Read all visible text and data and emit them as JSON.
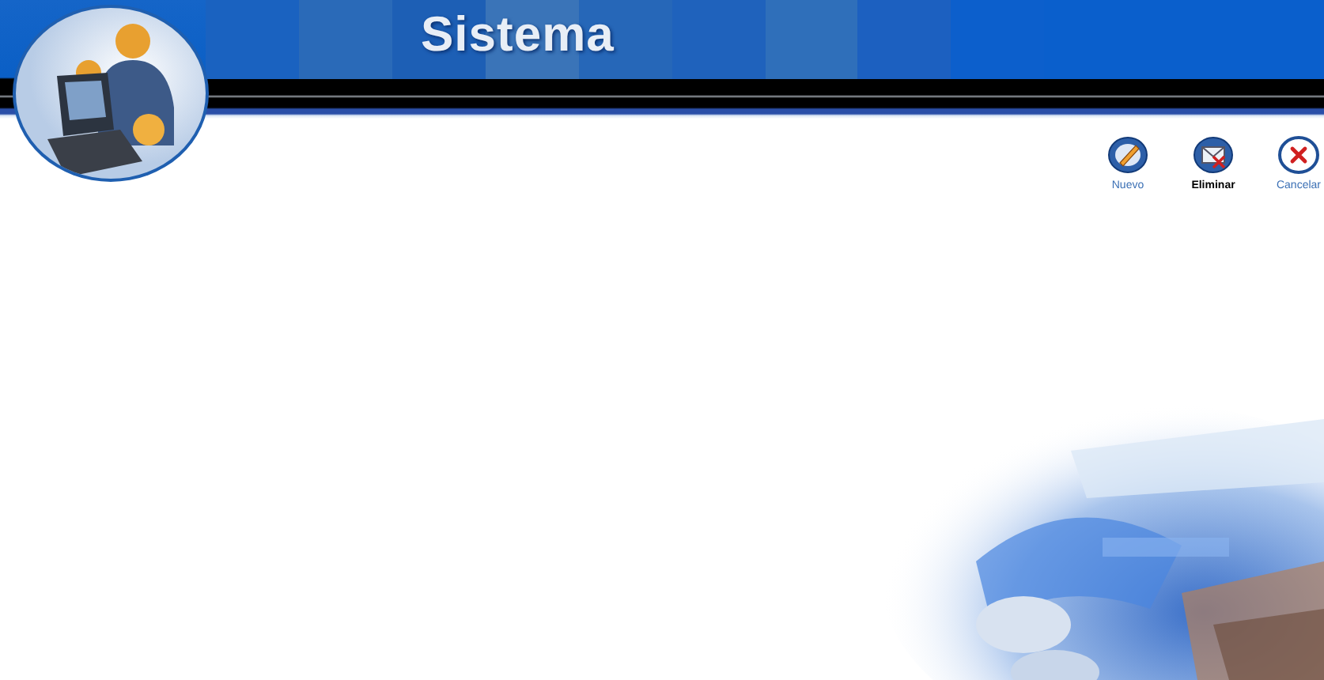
{
  "header": {
    "title": "Sistema"
  },
  "toolbar": [
    {
      "label": "Nuevo",
      "kind": "new",
      "selected": false
    },
    {
      "label": "Eliminar",
      "kind": "delete",
      "selected": true
    },
    {
      "label": "Cancelar",
      "kind": "cancel",
      "selected": false
    }
  ]
}
